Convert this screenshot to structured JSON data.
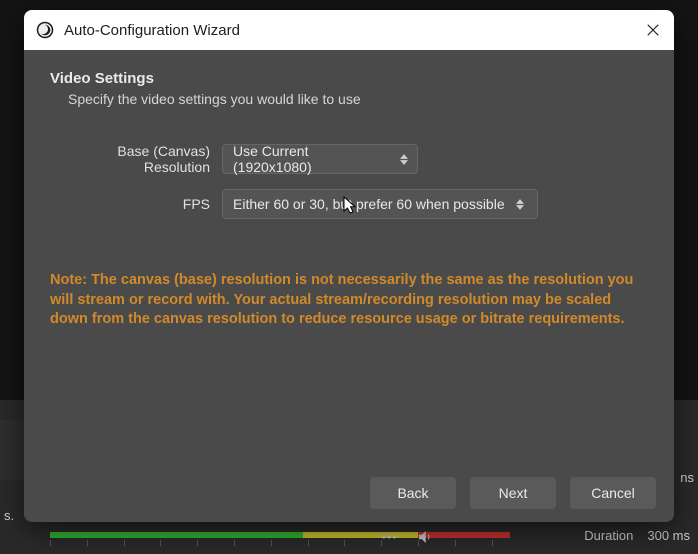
{
  "dialog": {
    "title": "Auto-Configuration Wizard",
    "section_title": "Video Settings",
    "section_sub": "Specify the video settings you would like to use",
    "resolution_label": "Base (Canvas) Resolution",
    "resolution_value": "Use Current (1920x1080)",
    "fps_label": "FPS",
    "fps_value": "Either 60 or 30, but prefer 60 when possible",
    "note": "Note: The canvas (base) resolution is not necessarily the same as the resolution you will stream or record with. Your actual stream/recording resolution may be scaled down from the canvas resolution to reduce resource usage or bitrate requirements.",
    "back": "Back",
    "next": "Next",
    "cancel": "Cancel"
  },
  "status": {
    "duration_label": "Duration",
    "duration_value": "300 ms"
  },
  "bg": {
    "trunc_right": "ns",
    "trunc_left": "s."
  }
}
